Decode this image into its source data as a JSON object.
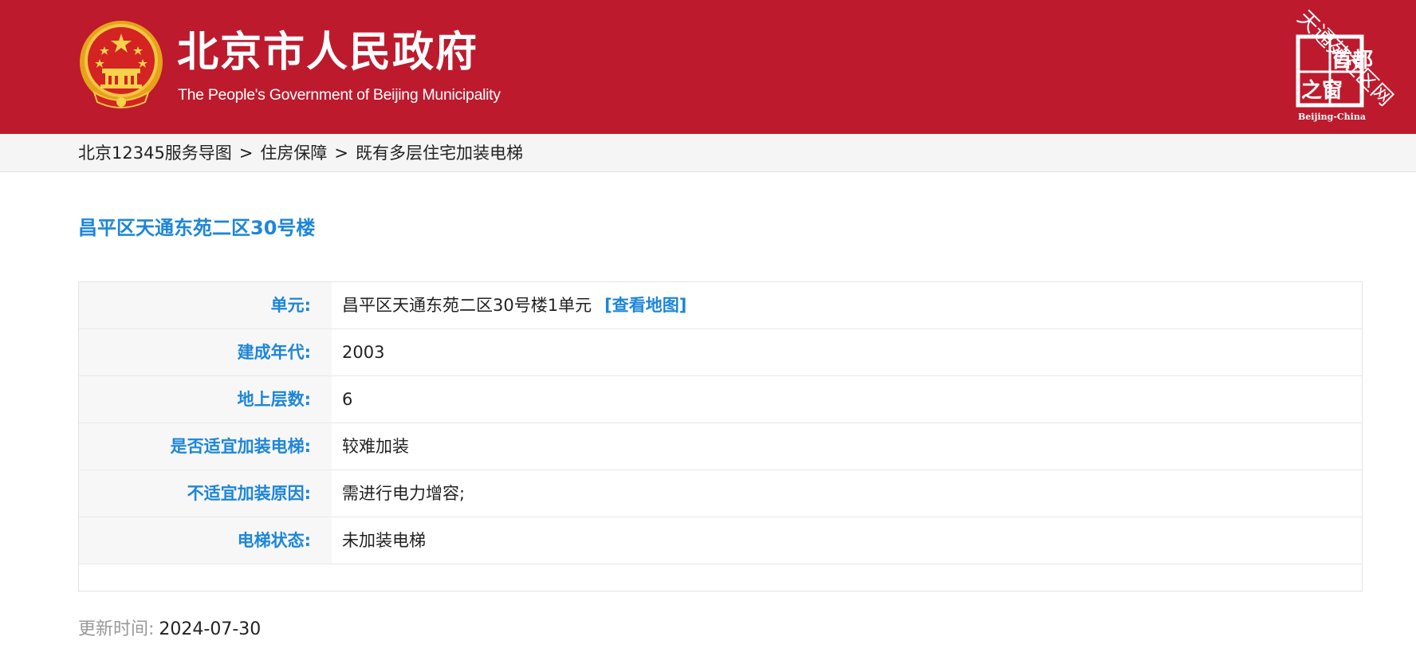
{
  "colors": {
    "header_bg": "#bd1a2d",
    "accent_blue": "#1d86d8",
    "label_bg": "#f7f7f7"
  },
  "header": {
    "emblem_icon": "national-emblem-icon",
    "title": "北京市人民政府",
    "subtitle": "The People's Government of Beijing Municipality",
    "capital_logo": {
      "icon": "capital-window-logo",
      "box_text_1": "首都",
      "box_text_2": "之窗",
      "caption": "Beijing-China",
      "watermark": "天通苑社区网"
    }
  },
  "breadcrumb": {
    "items": [
      "北京12345服务导图",
      "住房保障",
      "既有多层住宅加装电梯"
    ],
    "separator": ">"
  },
  "page_title": "昌平区天通东苑二区30号楼",
  "info": {
    "rows": [
      {
        "label": "单元:",
        "value": "昌平区天通东苑二区30号楼1单元",
        "link": "[查看地图]"
      },
      {
        "label": "建成年代:",
        "value": "2003"
      },
      {
        "label": "地上层数:",
        "value": "6"
      },
      {
        "label": "是否适宜加装电梯:",
        "value": "较难加装"
      },
      {
        "label": "不适宜加装原因:",
        "value": "需进行电力增容;"
      },
      {
        "label": "电梯状态:",
        "value": "未加装电梯"
      }
    ]
  },
  "update": {
    "label": "更新时间:",
    "value": "2024-07-30"
  }
}
